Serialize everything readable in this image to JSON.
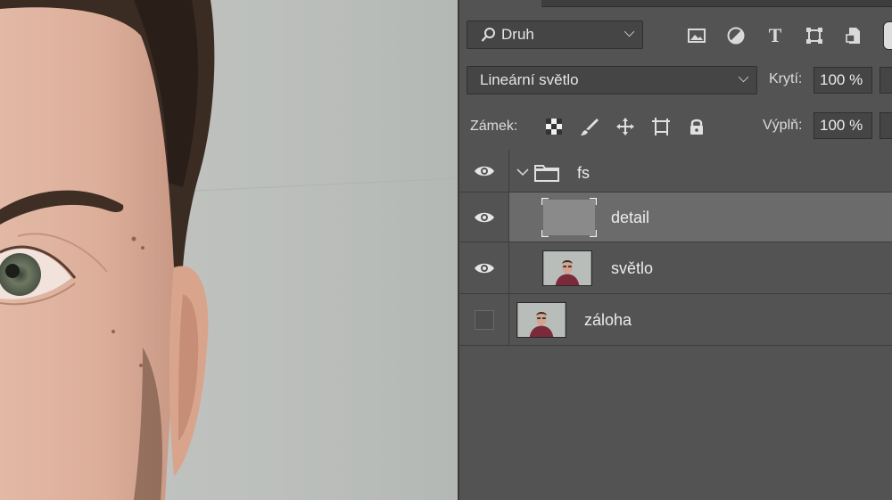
{
  "panel": {
    "filter": {
      "label": "Druh",
      "icon": "search-icon"
    },
    "filter_icons": [
      "image-filter-icon",
      "adjustment-filter-icon",
      "type-filter-icon",
      "shape-filter-icon",
      "smart-object-filter-icon"
    ],
    "type_icon_glyph": "T",
    "blend_mode": "Lineární světlo",
    "opacity_label": "Krytí:",
    "opacity_value": "100 %",
    "lock_label": "Zámek:",
    "lock_icons": [
      "lock-transparent-icon",
      "lock-image-icon",
      "lock-position-icon",
      "lock-artboard-icon",
      "lock-all-icon"
    ],
    "fill_label": "Výplň:",
    "fill_value": "100 %"
  },
  "layers": [
    {
      "name": "fs",
      "type": "group",
      "visible": true,
      "expanded": true,
      "selected": false
    },
    {
      "name": "detail",
      "type": "layer",
      "visible": true,
      "selected": true,
      "thumb": "gray-fill"
    },
    {
      "name": "světlo",
      "type": "layer",
      "visible": true,
      "selected": false,
      "thumb": "photo"
    },
    {
      "name": "záloha",
      "type": "layer",
      "visible": false,
      "selected": false,
      "thumb": "photo"
    }
  ],
  "colors": {
    "panel_bg": "#535353",
    "selected_row": "#6b6b6b",
    "canvas_bg": "#bcbfbc"
  }
}
